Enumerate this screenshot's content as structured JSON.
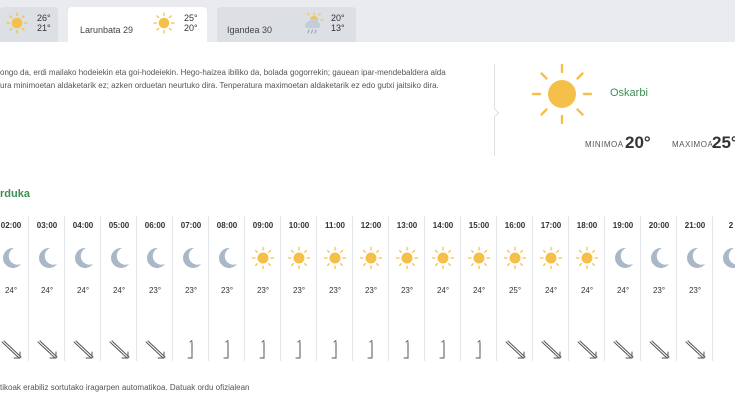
{
  "tabs": [
    {
      "label": "",
      "icon": "sun-icon",
      "max": "26°",
      "min": "21°"
    },
    {
      "label": "Larunbata 29",
      "icon": "sun-icon",
      "max": "25°",
      "min": "20°",
      "active": true
    },
    {
      "label": "Igandea 30",
      "icon": "sun-cloud-rain-icon",
      "max": "20°",
      "min": "13°"
    }
  ],
  "forecast": {
    "description_line1": "ongo da, erdi mailako hodeiekin eta goi-hodeiekin. Hego-haizea ibiliko da, bolada gogorrekin; gauean ipar-mendebaldera alda",
    "description_line2": "ura minimoetan aldaketarik ez; azken orduetan neurtuko dira. Tenperatura maximoetan aldaketarik ez edo gutxi jaitsiko dira.",
    "summary_icon": "sun-icon",
    "summary_label": "Oskarbi",
    "min_label": "MINIMOA",
    "min_value": "20°",
    "max_label": "MAXIMOA",
    "max_value": "25°"
  },
  "hourly_title": "rduka",
  "hourly": [
    {
      "time": "02:00",
      "icon": "moon-icon",
      "temp": "24°",
      "wind": "nw"
    },
    {
      "time": "03:00",
      "icon": "moon-icon",
      "temp": "24°",
      "wind": "nw"
    },
    {
      "time": "04:00",
      "icon": "moon-icon",
      "temp": "24°",
      "wind": "nw"
    },
    {
      "time": "05:00",
      "icon": "moon-icon",
      "temp": "24°",
      "wind": "nw"
    },
    {
      "time": "06:00",
      "icon": "moon-icon",
      "temp": "23°",
      "wind": "nw"
    },
    {
      "time": "07:00",
      "icon": "moon-icon",
      "temp": "23°",
      "wind": "n"
    },
    {
      "time": "08:00",
      "icon": "moon-icon",
      "temp": "23°",
      "wind": "n"
    },
    {
      "time": "09:00",
      "icon": "sun-icon",
      "temp": "23°",
      "wind": "n"
    },
    {
      "time": "10:00",
      "icon": "sun-icon",
      "temp": "23°",
      "wind": "n"
    },
    {
      "time": "11:00",
      "icon": "sun-icon",
      "temp": "23°",
      "wind": "n"
    },
    {
      "time": "12:00",
      "icon": "sun-icon",
      "temp": "23°",
      "wind": "n"
    },
    {
      "time": "13:00",
      "icon": "sun-icon",
      "temp": "23°",
      "wind": "n"
    },
    {
      "time": "14:00",
      "icon": "sun-icon",
      "temp": "24°",
      "wind": "n"
    },
    {
      "time": "15:00",
      "icon": "sun-icon",
      "temp": "24°",
      "wind": "n"
    },
    {
      "time": "16:00",
      "icon": "sun-icon",
      "temp": "25°",
      "wind": "nw"
    },
    {
      "time": "17:00",
      "icon": "sun-icon",
      "temp": "24°",
      "wind": "nw"
    },
    {
      "time": "18:00",
      "icon": "sun-icon",
      "temp": "24°",
      "wind": "nw"
    },
    {
      "time": "19:00",
      "icon": "moon-icon",
      "temp": "24°",
      "wind": "nw"
    },
    {
      "time": "20:00",
      "icon": "moon-icon",
      "temp": "23°",
      "wind": "nw"
    },
    {
      "time": "21:00",
      "icon": "moon-icon",
      "temp": "23°",
      "wind": "nw"
    },
    {
      "time": "2",
      "icon": "moon-icon",
      "temp": "",
      "wind": ""
    }
  ],
  "footer": "tikoak erabiliz sortutako iragarpen automatikoa. Datuak ordu ofizialean",
  "colors": {
    "accent": "#3d8f52",
    "sun": "#f5c04a",
    "moon": "#a9b7c6"
  }
}
